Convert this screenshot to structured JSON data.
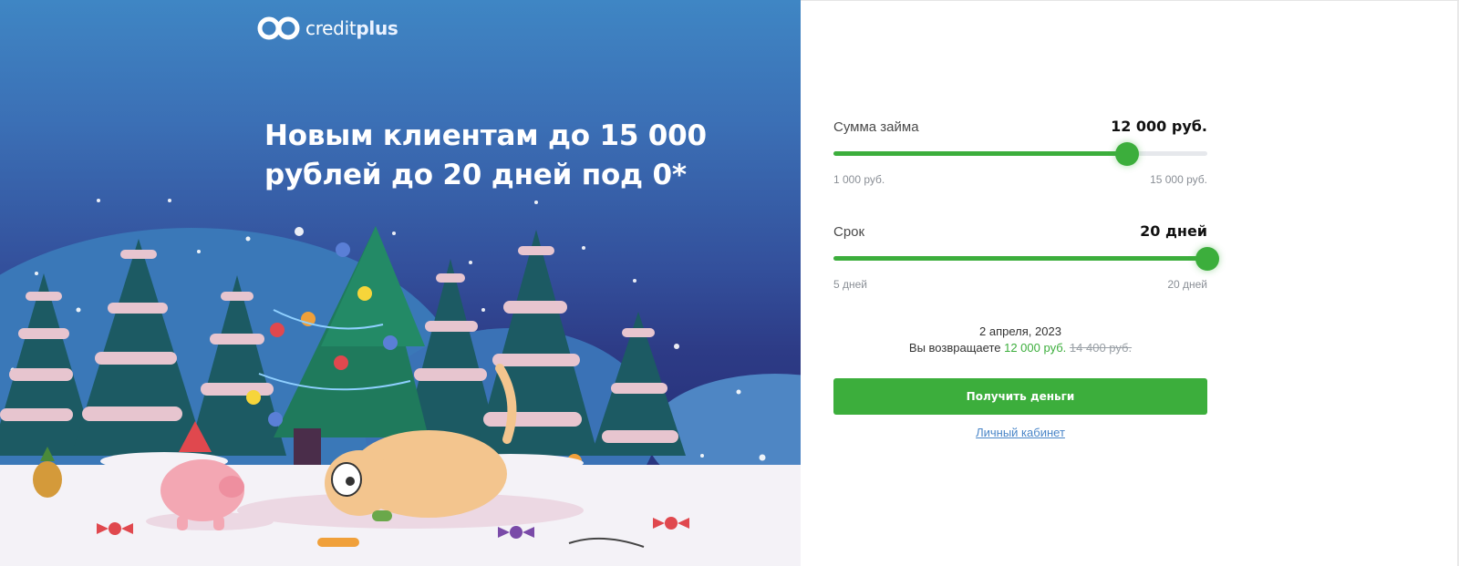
{
  "brand": {
    "name_part1": "credit",
    "name_part2": "plus"
  },
  "hero": {
    "headline": "Новым клиентам до 15 000 рублей до 20 дней под 0*"
  },
  "amount": {
    "label": "Сумма займа",
    "value": "12 000 руб.",
    "min_label": "1 000 руб.",
    "max_label": "15 000 руб.",
    "min": 1000,
    "max": 15000,
    "current": 12000
  },
  "term": {
    "label": "Срок",
    "value": "20 дней",
    "min_label": "5 дней",
    "max_label": "20 дней",
    "min": 5,
    "max": 20,
    "current": 20
  },
  "summary": {
    "date": "2 апреля, 2023",
    "return_prefix": "Вы возвращаете",
    "return_amount": "12 000 руб.",
    "old_amount": "14 400 руб."
  },
  "actions": {
    "get_money": "Получить деньги",
    "cabinet": "Личный кабинет"
  },
  "colors": {
    "accent": "#3cae3c",
    "link": "#4a86c8",
    "sky_top": "#3f86c4",
    "sky_bottom": "#2a3680"
  }
}
